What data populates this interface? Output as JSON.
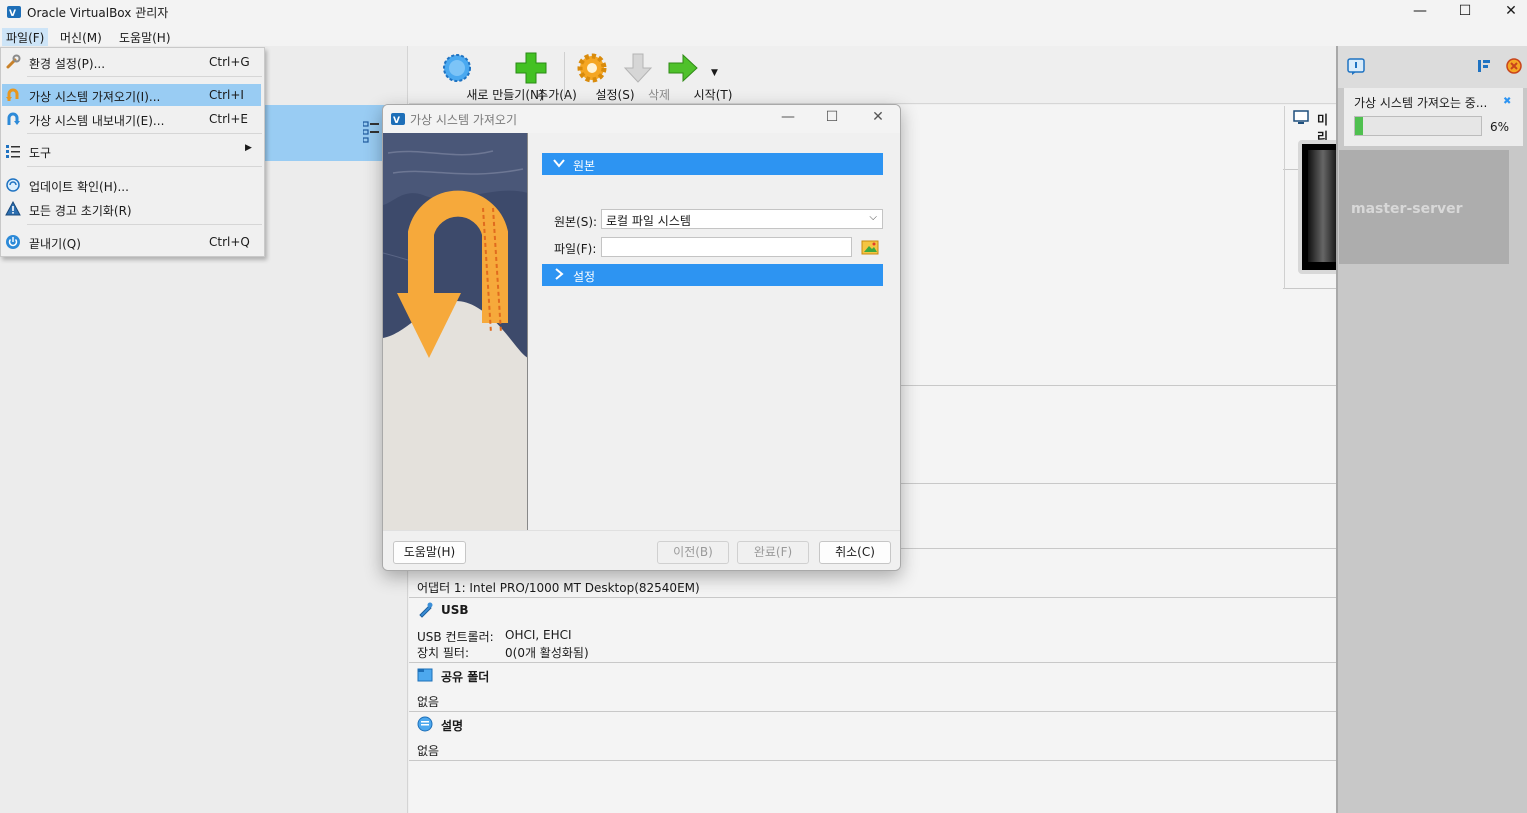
{
  "window": {
    "title": "Oracle VirtualBox 관리자",
    "minimize": "—",
    "maximize": "☐",
    "close": "✕"
  },
  "menubar": {
    "file": "파일(F)",
    "machine": "머신(M)",
    "help": "도움말(H)"
  },
  "file_menu": [
    {
      "label": "환경 설정(P)...",
      "shortcut": "Ctrl+G",
      "icon": "wrench-icon"
    },
    {
      "label": "가상 시스템 가져오기(I)...",
      "shortcut": "Ctrl+I",
      "icon": "import-icon",
      "highlighted": true
    },
    {
      "label": "가상 시스템 내보내기(E)...",
      "shortcut": "Ctrl+E",
      "icon": "export-icon"
    },
    {
      "label": "도구",
      "icon": "tools-icon",
      "submenu_arrow": "▶"
    },
    {
      "label": "업데이트 확인(H)...",
      "icon": "update-icon"
    },
    {
      "label": "모든 경고 초기화(R)",
      "icon": "warning-icon"
    },
    {
      "label": "끝내기(Q)",
      "shortcut": "Ctrl+Q",
      "icon": "power-icon"
    }
  ],
  "toolbar": {
    "new": "새로 만들기(N)",
    "add": "추가(A)",
    "settings": "설정(S)",
    "delete": "삭제",
    "start": "시작(T)"
  },
  "details": {
    "network_adapter": "어댑터 1:   Intel PRO/1000 MT Desktop(82540EM)",
    "usb_title": "USB",
    "usb_controller_label": "USB 컨트롤러:",
    "usb_controller_value": "OHCI, EHCI",
    "usb_filters_label": "장치 필터:",
    "usb_filters_value": "0(0개 활성화됨)",
    "shared_title": "공유 폴더",
    "shared_value": "없음",
    "desc_title": "설명",
    "desc_value": "없음"
  },
  "preview": {
    "title": "미리",
    "vm_name": "master-server"
  },
  "notification": {
    "title": "가상 시스템 가져오는 중...",
    "progress_percent": 6,
    "progress_label": "6%"
  },
  "dialog": {
    "title": "가상 시스템 가져오기",
    "source_section": "원본",
    "source_label": "원본(S):",
    "source_value": "로컬 파일 시스템",
    "file_label": "파일(F):",
    "file_value": "",
    "settings_section": "설정",
    "help_button": "도움말(H)",
    "back_button": "이전(B)",
    "finish_button": "완료(F)",
    "cancel_button": "취소(C)"
  },
  "colors": {
    "accent": "#2d94f2",
    "selection": "#99ccf3",
    "progress": "#4fc04f"
  }
}
